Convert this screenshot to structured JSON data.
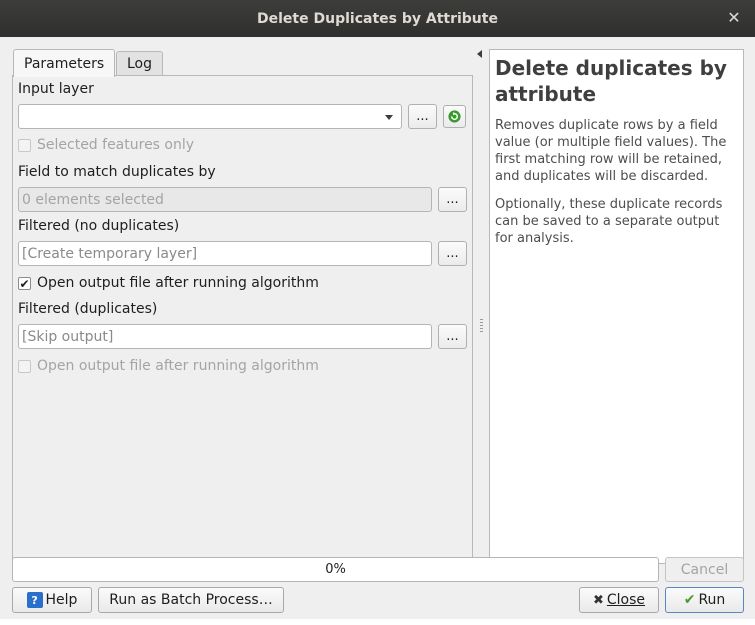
{
  "window": {
    "title": "Delete Duplicates by Attribute"
  },
  "tabs": [
    {
      "label": "Parameters"
    },
    {
      "label": "Log"
    }
  ],
  "params": {
    "input_layer_label": "Input layer",
    "selected_only_label": "Selected features only",
    "field_label": "Field to match duplicates by",
    "field_value": "0 elements selected",
    "filtered_label": "Filtered (no duplicates)",
    "filtered_value": "[Create temporary layer]",
    "open_output_1_label": "Open output file after running algorithm",
    "open_output_1_checked": "✔",
    "filtered_dup_label": "Filtered (duplicates)",
    "filtered_dup_value": "[Skip output]",
    "open_output_2_label": "Open output file after running algorithm",
    "dots": "..."
  },
  "help": {
    "title": "Delete duplicates by attribute",
    "paragraph1": "Removes duplicate rows by a field value (or multiple field values). The first matching row will be retained, and duplicates will be discarded.",
    "paragraph2": "Optionally, these duplicate records can be saved to a separate output for analysis."
  },
  "footer": {
    "progress_text": "0%",
    "progress_fraction": 0,
    "cancel_label": "Cancel",
    "help_label": "Help",
    "help_icon_glyph": "?",
    "batch_label": "Run as Batch Process…",
    "close_label": "Close",
    "close_icon_glyph": "✖",
    "run_label": "Run",
    "run_icon_glyph": "✔"
  },
  "icons": {
    "close": "close-icon",
    "refresh": "refresh-icon",
    "help": "help-icon",
    "run": "checkmark-icon"
  },
  "colors": {
    "titlebar": "#2f2f2d",
    "window_bg": "#efefef",
    "help_icon": "#2a6fc9",
    "run_check": "#4a9a2a",
    "refresh_icon": "#3b9a2e"
  }
}
